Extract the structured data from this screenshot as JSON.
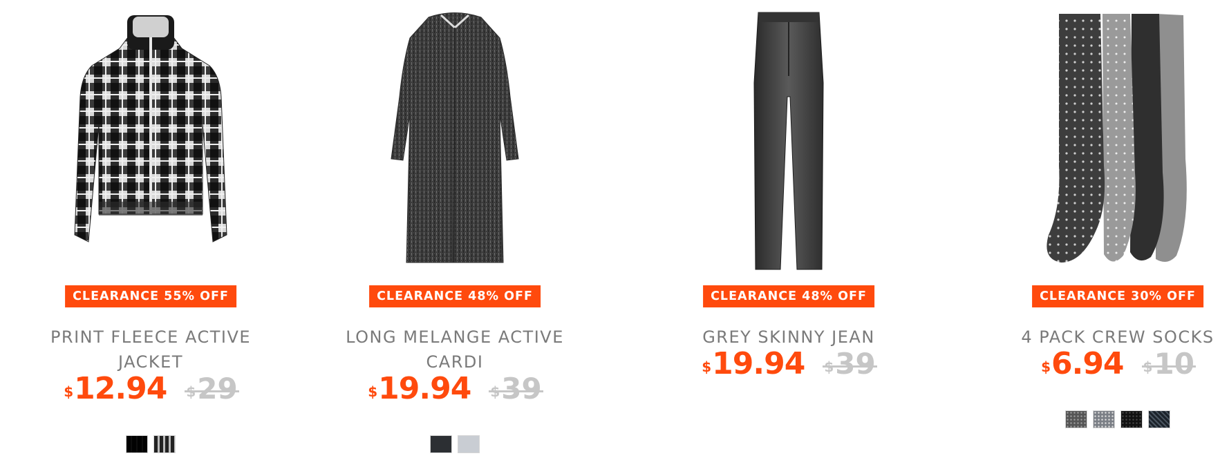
{
  "products": [
    {
      "badge": "CLEARANCE 55% OFF",
      "title_line1": "PRINT FLEECE ACTIVE",
      "title_line2": "JACKET",
      "price_currency": "$",
      "price": "12.94",
      "was_currency": "$",
      "was": "29",
      "swatches": [
        "black-plaid",
        "grey-plaid"
      ]
    },
    {
      "badge": "CLEARANCE 48% OFF",
      "title_line1": "LONG MELANGE ACTIVE",
      "title_line2": "CARDI",
      "price_currency": "$",
      "price": "19.94",
      "was_currency": "$",
      "was": "39",
      "swatches": [
        "charcoal",
        "light-grey"
      ]
    },
    {
      "badge": "CLEARANCE 48% OFF",
      "title_line1": "GREY SKINNY JEAN",
      "price_currency": "$",
      "price": "19.94",
      "was_currency": "$",
      "was": "39"
    },
    {
      "badge": "CLEARANCE 30% OFF",
      "title_line1": "4 PACK CREW SOCKS",
      "price_currency": "$",
      "price": "6.94",
      "was_currency": "$",
      "was": "10",
      "swatches": [
        "charcoal-dot",
        "grey-dot",
        "black-dot",
        "navy-pattern"
      ]
    }
  ],
  "colors": {
    "accent": "#ff4a0d",
    "title": "#7a7a7a",
    "was_price": "#c6c6c6"
  }
}
